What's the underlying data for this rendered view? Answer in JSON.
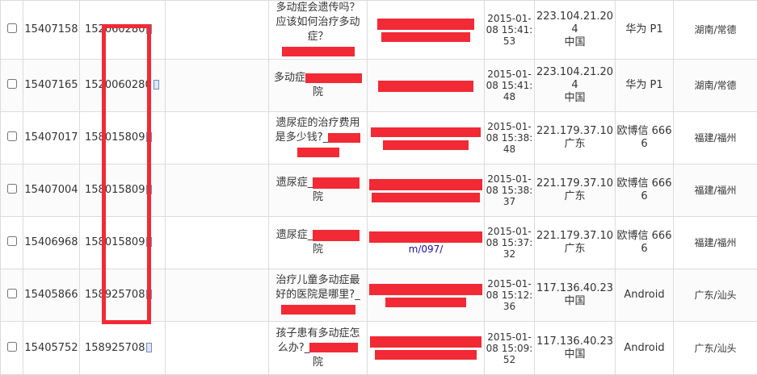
{
  "rows": [
    {
      "id": "15407158",
      "phone_start": "152",
      "phone_visible": "06028",
      "phone_end": "0",
      "question": "多动症会遗传吗？应该如何治疗多动症？",
      "time": "2015-01-08 15:41:53",
      "ip": "223.104.21.204",
      "ip_region": "中国",
      "device": "华为 P1",
      "location": "湖南/常德"
    },
    {
      "id": "15407165",
      "phone_start": "152",
      "phone_visible": "006028",
      "phone_end": "0",
      "question": "多动症",
      "question_end": "院",
      "time": "2015-01-08 15:41:48",
      "ip": "223.104.21.204",
      "ip_region": "中国",
      "device": "华为 P1",
      "location": "湖南/常德"
    },
    {
      "id": "15407017",
      "phone_start": "15",
      "phone_visible": "801580",
      "phone_end": "9",
      "question": "遗尿症的治疗费用是多少钱?_",
      "time": "2015-01-08 15:38:48",
      "ip": "221.179.37.10",
      "ip_region": "广东",
      "device": "欧博信 6666",
      "location": "福建/福州"
    },
    {
      "id": "15407004",
      "phone_start": "15",
      "phone_visible": "801580",
      "phone_end": "9",
      "question": "遗尿症_",
      "question_end": "院",
      "time": "2015-01-08 15:38:37",
      "ip": "221.179.37.10",
      "ip_region": "广东",
      "device": "欧博信 6666",
      "location": "福建/福州"
    },
    {
      "id": "15406968",
      "phone_start": "15",
      "phone_visible": "801580",
      "phone_end": "9",
      "question": "遗尿症_",
      "question_end": "院",
      "url_visible": "m/097/",
      "time": "2015-01-08 15:37:32",
      "ip": "221.179.37.10",
      "ip_region": "广东",
      "device": "欧博信 6666",
      "location": "福建/福州"
    },
    {
      "id": "15405866",
      "phone_start": "15",
      "phone_visible": "892570",
      "phone_end": "8",
      "question": "治疗儿童多动症最好的医院是哪里?_",
      "time": "2015-01-08 15:12:36",
      "ip": "117.136.40.23",
      "ip_region": "中国",
      "device": "Android",
      "location": "广东/汕头"
    },
    {
      "id": "15405752",
      "phone_start": "15",
      "phone_visible": "892570",
      "phone_end": "8",
      "question": "孩子患有多动症怎么办?_",
      "question_end": "院",
      "time": "2015-01-08 15:09:52",
      "ip": "117.136.40.23",
      "ip_region": "中国",
      "device": "Android",
      "location": "广东/汕头"
    }
  ],
  "colors": {
    "redaction": "#f22a35",
    "link": "#1a0dab",
    "border": "#dcdcdc"
  }
}
